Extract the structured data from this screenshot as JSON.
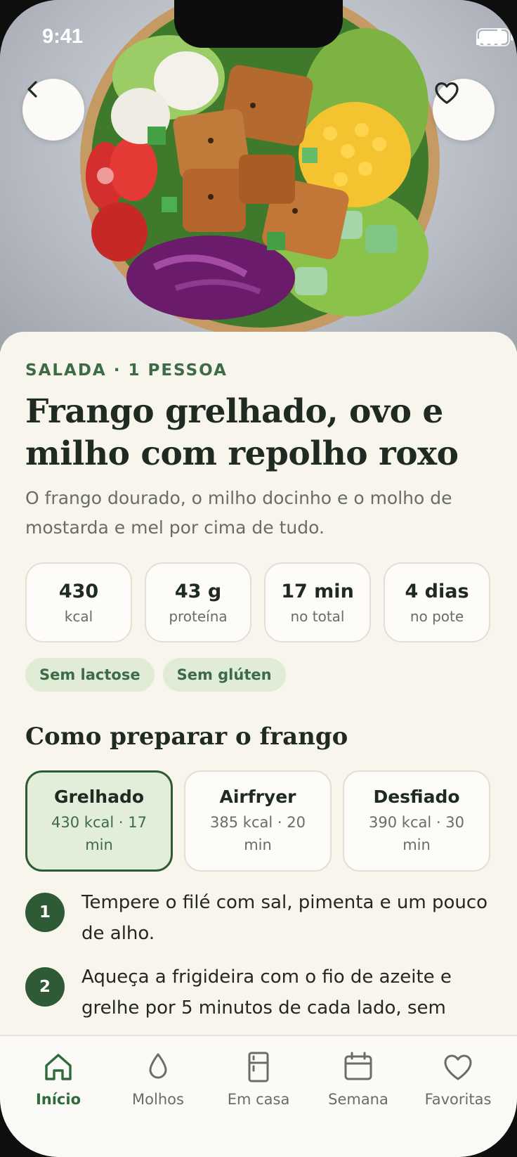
{
  "status_bar": {
    "time": "9:41"
  },
  "hero": {
    "image": "salad-bowl-photo",
    "back_icon": "chevron-left-icon",
    "favorite_icon": "heart-icon"
  },
  "recipe": {
    "eyebrow": "SALADA · 1 PESSOA",
    "title": "Frango grelhado, ovo e milho com repolho roxo",
    "description": "O frango dourado, o milho docinho e o molho de mostarda e mel por cima de tudo.",
    "stats": [
      {
        "value": "430",
        "label": "kcal"
      },
      {
        "value": "43 g",
        "label": "proteína"
      },
      {
        "value": "17 min",
        "label": "no total"
      },
      {
        "value": "4 dias",
        "label": "no pote"
      }
    ],
    "tags": [
      "Sem lactose",
      "Sem glúten"
    ]
  },
  "preparation": {
    "section_title": "Como preparar o frango",
    "options": [
      {
        "name": "Grelhado",
        "meta": "430 kcal · 17 min",
        "selected": true
      },
      {
        "name": "Airfryer",
        "meta": "385 kcal · 20 min",
        "selected": false
      },
      {
        "name": "Desfiado",
        "meta": "390 kcal · 30 min",
        "selected": false
      }
    ],
    "steps": [
      {
        "number": "1",
        "text": "Tempere o filé com sal, pimenta e um pouco de alho."
      },
      {
        "number": "2",
        "text": "Aqueça a frigideira com o fio de azeite e grelhe por 5 minutos de cada lado, sem"
      }
    ]
  },
  "tabbar": {
    "items": [
      {
        "label": "Início",
        "icon": "home-icon",
        "active": true
      },
      {
        "label": "Molhos",
        "icon": "drop-icon",
        "active": false
      },
      {
        "label": "Em casa",
        "icon": "fridge-icon",
        "active": false
      },
      {
        "label": "Semana",
        "icon": "calendar-icon",
        "active": false
      },
      {
        "label": "Favoritas",
        "icon": "heart-icon",
        "active": false
      }
    ]
  },
  "colors": {
    "accent": "#2e5a36",
    "accent_text": "#3d6b45",
    "tag_bg": "#e1ecd7",
    "background": "#f7f5ec"
  }
}
